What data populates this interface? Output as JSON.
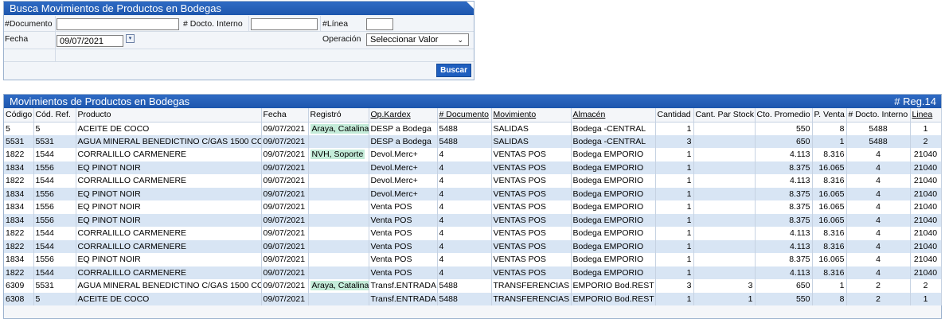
{
  "search": {
    "title": "Busca Movimientos de Productos en Bodegas",
    "doc_label": "#Documento",
    "doc_value": "",
    "docto_interno_label": "# Docto. Interno",
    "docto_interno_value": "",
    "linea_label": "#Línea",
    "linea_value": "",
    "fecha_label": "Fecha",
    "fecha_value": "09/07/2021",
    "operacion_label": "Operación",
    "operacion_value": "Seleccionar Valor",
    "buscar_label": "Buscar"
  },
  "results": {
    "title": "Movimientos de Productos en Bodegas",
    "count": "# Reg.14",
    "columns": [
      "Código",
      "Cód. Ref.",
      "Producto",
      "Fecha",
      "Registró",
      "Op.Kardex",
      "# Documento",
      "Movimiento",
      "Almacén",
      "Cantidad",
      "Cant. Par Stock",
      "Cto. Promedio",
      "P. Venta",
      "# Docto. Interno",
      "Linea"
    ],
    "rows": [
      [
        "5",
        "5",
        "ACEITE DE COCO",
        "09/07/2021",
        "Araya, Catalina",
        "DESP a Bodega",
        "5488",
        "SALIDAS",
        "Bodega -CENTRAL",
        "1",
        "",
        "550",
        "8",
        "5488",
        "1"
      ],
      [
        "5531",
        "5531",
        "AGUA MINERAL BENEDICTINO C/GAS 1500 CC",
        "09/07/2021",
        "",
        "DESP a Bodega",
        "5488",
        "SALIDAS",
        "Bodega -CENTRAL",
        "3",
        "",
        "650",
        "1",
        "5488",
        "2"
      ],
      [
        "1822",
        "1544",
        "CORRALILLO CARMENERE",
        "09/07/2021",
        "NVH, Soporte",
        "Devol.Merc+",
        "4",
        "VENTAS POS",
        "Bodega EMPORIO",
        "1",
        "",
        "4.113",
        "8.316",
        "4",
        "21040"
      ],
      [
        "1834",
        "1556",
        "EQ PINOT NOIR",
        "09/07/2021",
        "",
        "Devol.Merc+",
        "4",
        "VENTAS POS",
        "Bodega EMPORIO",
        "1",
        "",
        "8.375",
        "16.065",
        "4",
        "21040"
      ],
      [
        "1822",
        "1544",
        "CORRALILLO CARMENERE",
        "09/07/2021",
        "",
        "Devol.Merc+",
        "4",
        "VENTAS POS",
        "Bodega EMPORIO",
        "1",
        "",
        "4.113",
        "8.316",
        "4",
        "21040"
      ],
      [
        "1834",
        "1556",
        "EQ PINOT NOIR",
        "09/07/2021",
        "",
        "Devol.Merc+",
        "4",
        "VENTAS POS",
        "Bodega EMPORIO",
        "1",
        "",
        "8.375",
        "16.065",
        "4",
        "21040"
      ],
      [
        "1834",
        "1556",
        "EQ PINOT NOIR",
        "09/07/2021",
        "",
        "Venta POS",
        "4",
        "VENTAS POS",
        "Bodega EMPORIO",
        "1",
        "",
        "8.375",
        "16.065",
        "4",
        "21040"
      ],
      [
        "1834",
        "1556",
        "EQ PINOT NOIR",
        "09/07/2021",
        "",
        "Venta POS",
        "4",
        "VENTAS POS",
        "Bodega EMPORIO",
        "1",
        "",
        "8.375",
        "16.065",
        "4",
        "21040"
      ],
      [
        "1822",
        "1544",
        "CORRALILLO CARMENERE",
        "09/07/2021",
        "",
        "Venta POS",
        "4",
        "VENTAS POS",
        "Bodega EMPORIO",
        "1",
        "",
        "4.113",
        "8.316",
        "4",
        "21040"
      ],
      [
        "1822",
        "1544",
        "CORRALILLO CARMENERE",
        "09/07/2021",
        "",
        "Venta POS",
        "4",
        "VENTAS POS",
        "Bodega EMPORIO",
        "1",
        "",
        "4.113",
        "8.316",
        "4",
        "21040"
      ],
      [
        "1834",
        "1556",
        "EQ PINOT NOIR",
        "09/07/2021",
        "",
        "Venta POS",
        "4",
        "VENTAS POS",
        "Bodega EMPORIO",
        "1",
        "",
        "8.375",
        "16.065",
        "4",
        "21040"
      ],
      [
        "1822",
        "1544",
        "CORRALILLO CARMENERE",
        "09/07/2021",
        "",
        "Venta POS",
        "4",
        "VENTAS POS",
        "Bodega EMPORIO",
        "1",
        "",
        "4.113",
        "8.316",
        "4",
        "21040"
      ],
      [
        "6309",
        "5531",
        "AGUA MINERAL BENEDICTINO C/GAS 1500 CC",
        "09/07/2021",
        "Araya, Catalina",
        "Transf.ENTRADA",
        "5488",
        "TRANSFERENCIAS",
        "EMPORIO Bod.REST",
        "3",
        "3",
        "650",
        "1",
        "2",
        "2"
      ],
      [
        "6308",
        "5",
        "ACEITE DE COCO",
        "09/07/2021",
        "",
        "Transf.ENTRADA",
        "5488",
        "TRANSFERENCIAS",
        "EMPORIO Bod.REST",
        "1",
        "1",
        "550",
        "8",
        "2",
        "1"
      ]
    ]
  }
}
